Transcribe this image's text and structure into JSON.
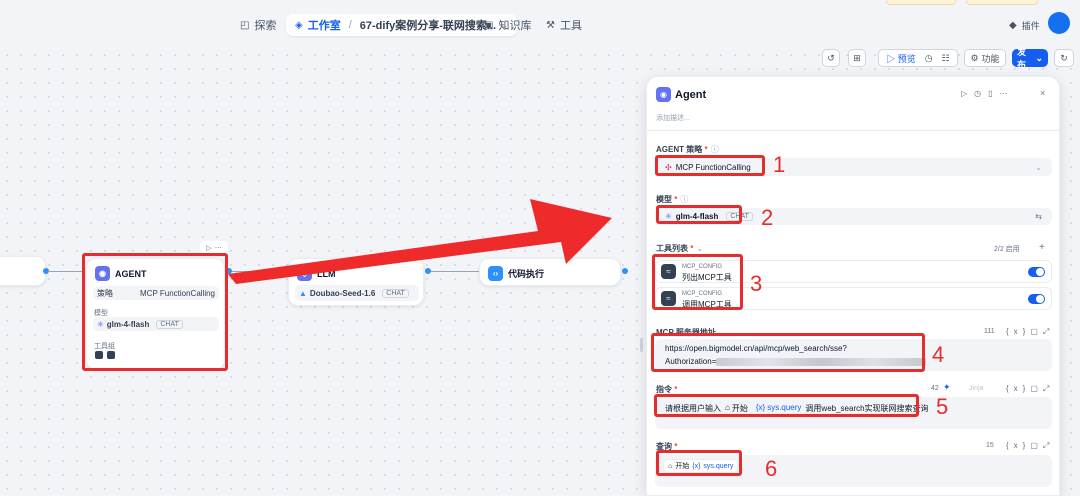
{
  "topnav": {
    "explore": "探索",
    "studio": "工作室",
    "app_name": "67-dify案例分享-联网搜索...",
    "knowledge": "知识库",
    "tools": "工具",
    "plugins": "插件"
  },
  "toolbar": {
    "preview": "预览",
    "features": "功能",
    "publish": "发布"
  },
  "canvas": {
    "agent_node": {
      "title": "AGENT",
      "strategy_label": "策略",
      "strategy_value": "MCP FunctionCalling",
      "model_label": "模型",
      "model_name": "glm-4-flash",
      "model_tag": "CHAT",
      "tools_label": "工具组"
    },
    "llm_node": {
      "title": "LLM",
      "model_name": "Doubao-Seed-1.6",
      "model_tag": "CHAT"
    },
    "code_node": {
      "title": "代码执行"
    }
  },
  "panel": {
    "title": "Agent",
    "description_placeholder": "添加描述...",
    "strategy": {
      "label": "AGENT 策略",
      "value": "MCP FunctionCalling"
    },
    "model": {
      "label": "模型",
      "value": "glm-4-flash",
      "tag": "CHAT"
    },
    "tools": {
      "label": "工具列表",
      "count": "2/2 启用",
      "items": [
        {
          "provider": "MCP_CONFIG",
          "name": "列出MCP工具"
        },
        {
          "provider": "MCP_CONFIG",
          "name": "调用MCP工具"
        }
      ]
    },
    "mcp_server": {
      "label": "MCP 服务器地址",
      "count": "111",
      "line1": "https://open.bigmodel.cn/api/mcp/web_search/sse?",
      "line2": "Authorization="
    },
    "instruction": {
      "label": "指令",
      "count": "42",
      "jinja": "Jinja",
      "text_before": "请根据用户输入",
      "var_node": "开始",
      "var_name": "sys.query",
      "text_after": "调用web_search实现联网搜索查询"
    },
    "query": {
      "label": "查询",
      "count": "15",
      "var_node": "开始",
      "var_name": "sys.query"
    }
  },
  "annotations": [
    "1",
    "2",
    "3",
    "4",
    "5",
    "6"
  ],
  "colors": {
    "accent": "#155eef",
    "annotation_red": "#e62d2d",
    "agent_icon": "#6172f3"
  }
}
